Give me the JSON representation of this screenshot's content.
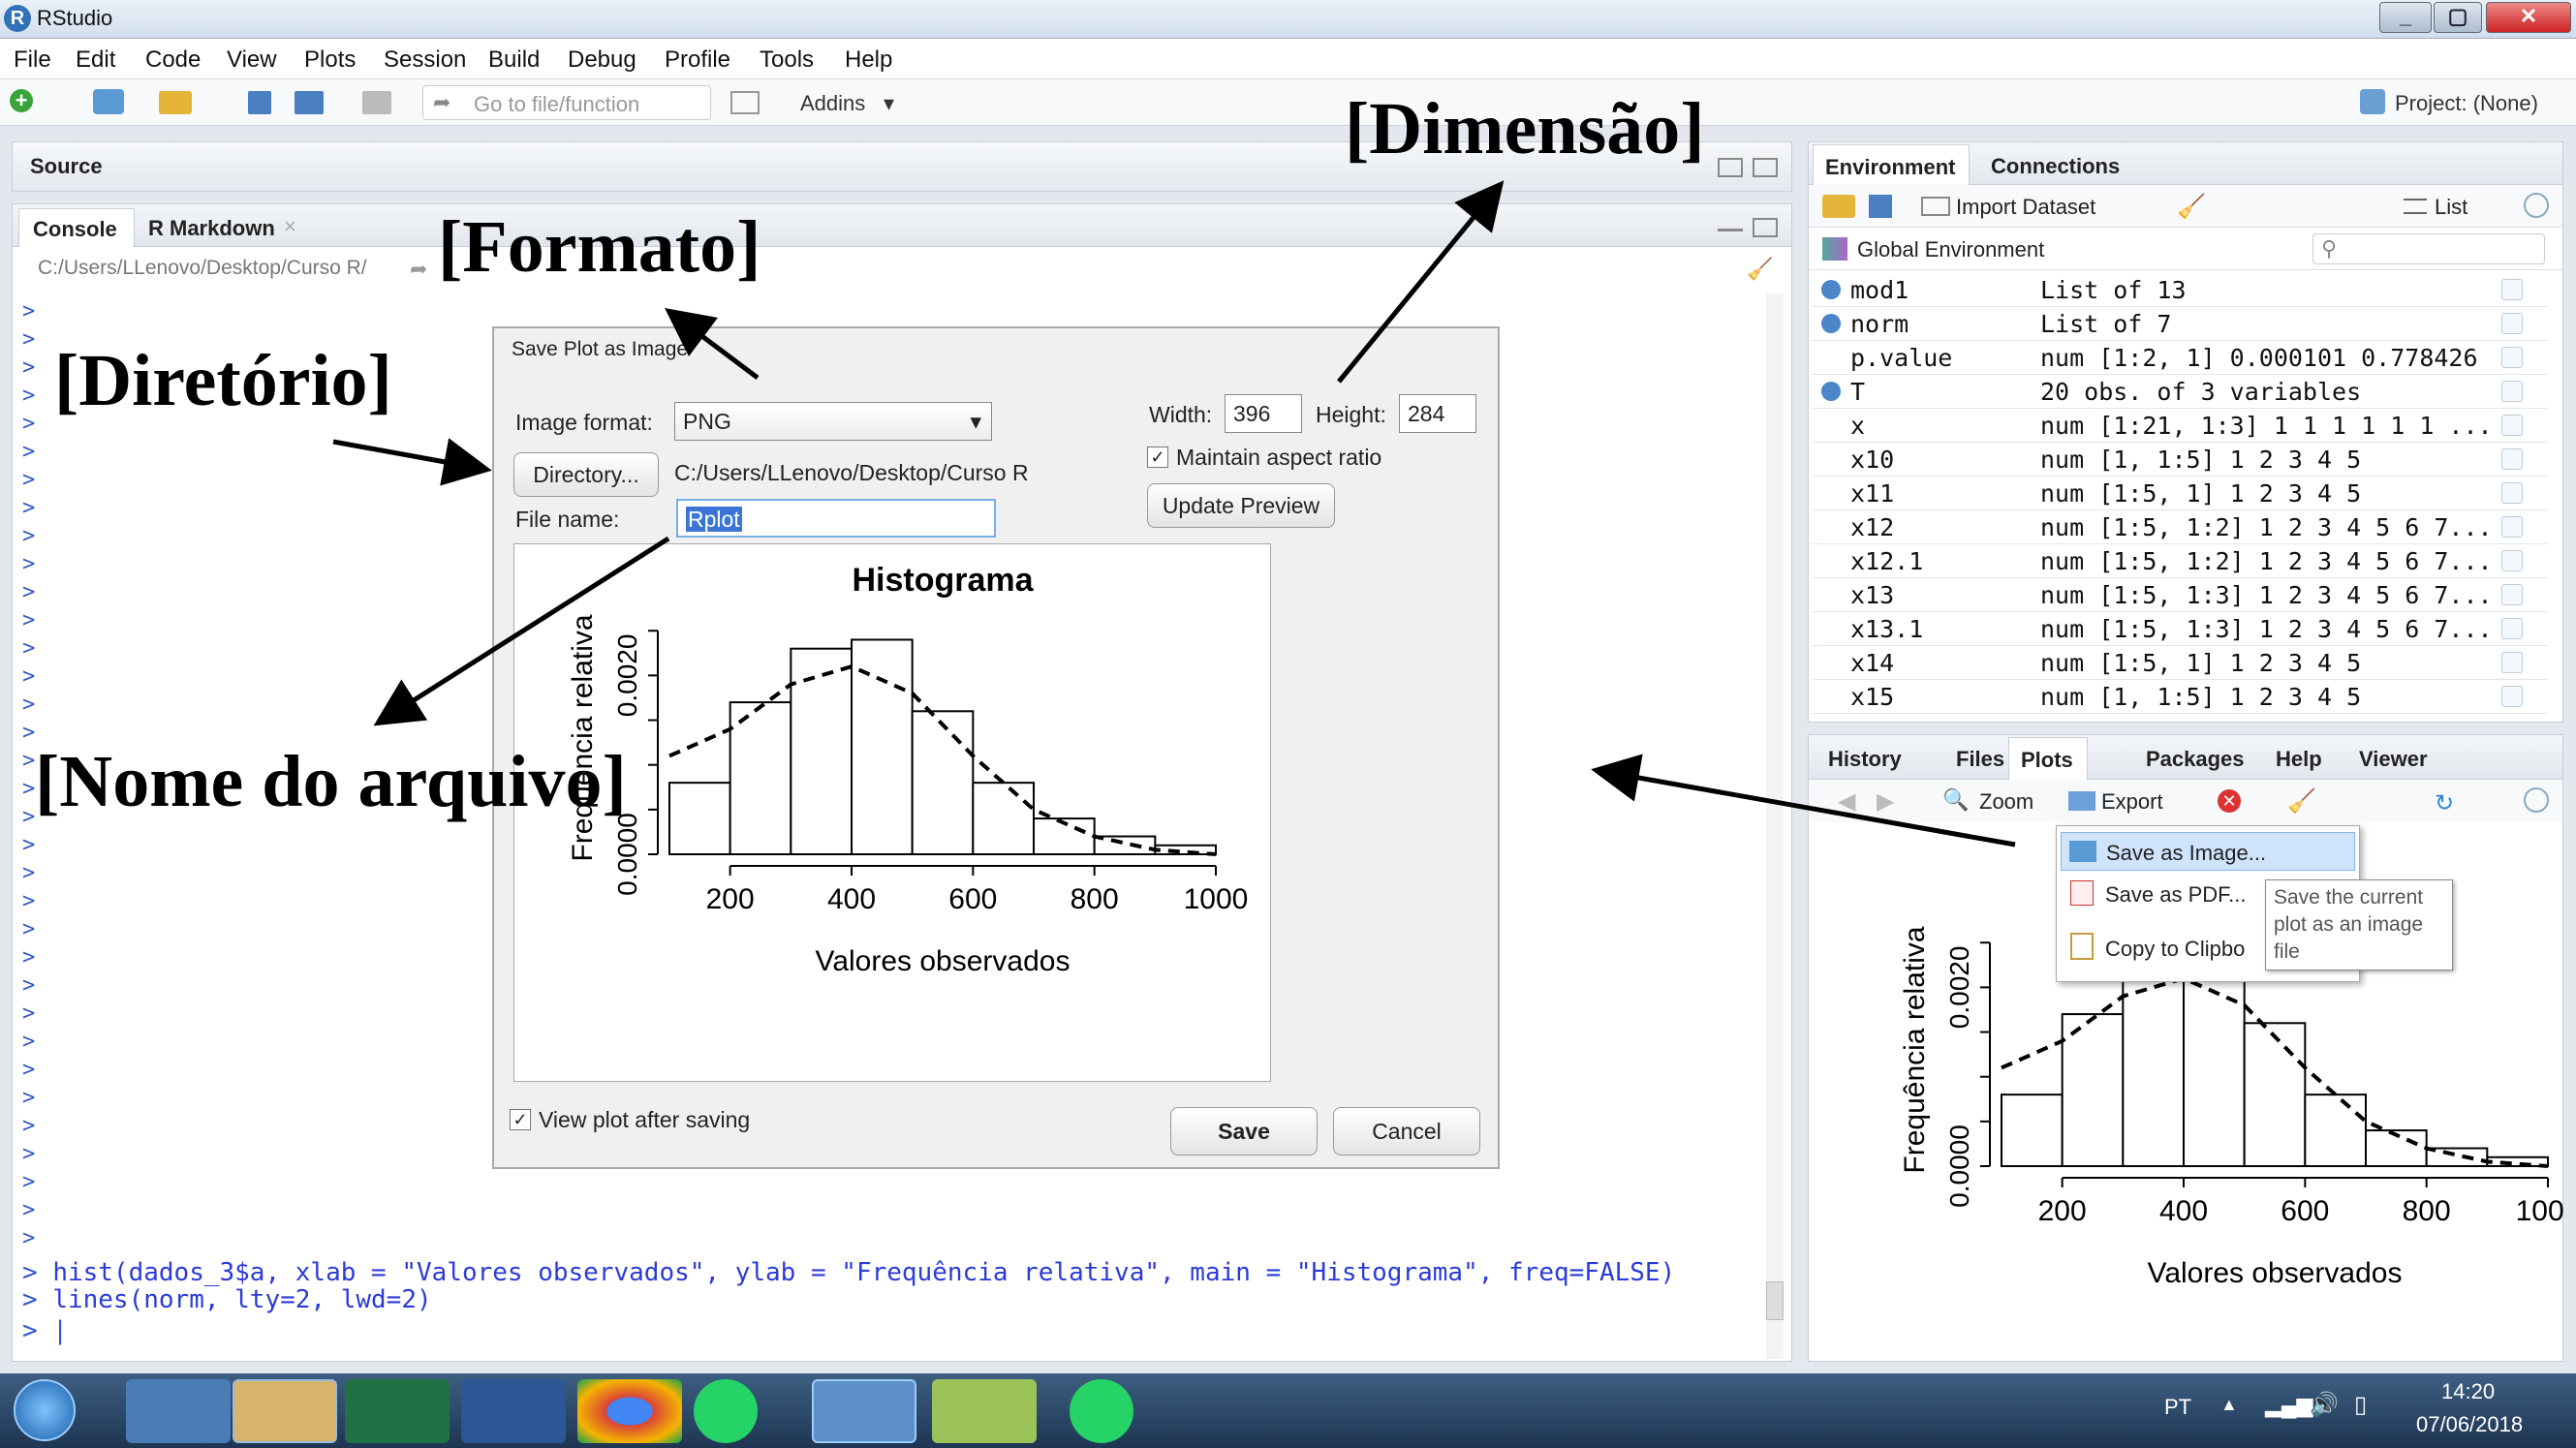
{
  "window": {
    "title": "RStudio",
    "min": "_",
    "max": "▢",
    "close": "✕"
  },
  "menu": [
    "File",
    "Edit",
    "Code",
    "View",
    "Plots",
    "Session",
    "Build",
    "Debug",
    "Profile",
    "Tools",
    "Help"
  ],
  "toolbar": {
    "goto_placeholder": "Go to file/function",
    "addins": "Addins",
    "project": "Project: (None)"
  },
  "source": {
    "label": "Source"
  },
  "console": {
    "tabs": [
      "Console",
      "R Markdown"
    ],
    "tab_close": "×",
    "path": "C:/Users/LLenovo/Desktop/Curso R/",
    "prompt": ">",
    "cmd1": "hist(dados_3$a, xlab = \"Valores observados\", ylab = \"Frequência relativa\", main = \"Histograma\", freq=FALSE)",
    "cmd2": "lines(norm, lty=2, lwd=2)"
  },
  "dialog": {
    "title": "Save Plot as Image",
    "format_label": "Image format:",
    "format_value": "PNG",
    "directory_button": "Directory...",
    "directory_path": "C:/Users/LLenovo/Desktop/Curso R",
    "filename_label": "File name:",
    "filename_value": "Rplot",
    "width_label": "Width:",
    "width_value": "396",
    "height_label": "Height:",
    "height_value": "284",
    "aspect_label": "Maintain aspect ratio",
    "update_button": "Update Preview",
    "view_after_label": "View plot after saving",
    "save_button": "Save",
    "cancel_button": "Cancel"
  },
  "histogram": {
    "title": "Histograma",
    "xlabel": "Valores observados",
    "ylabel": "Frequência relativa",
    "xticks": [
      "200",
      "400",
      "600",
      "800",
      "1000"
    ],
    "yticks": [
      "0.0000",
      "0.0020"
    ]
  },
  "chart_data": {
    "type": "bar",
    "title": "Histograma",
    "xlabel": "Valores observados",
    "ylabel": "Frequência relativa",
    "bin_edges": [
      100,
      200,
      300,
      400,
      500,
      600,
      700,
      800,
      900,
      1000
    ],
    "values": [
      0.0008,
      0.0017,
      0.0023,
      0.0024,
      0.0016,
      0.0008,
      0.0004,
      0.0002,
      0.0001
    ],
    "density_x": [
      100,
      200,
      300,
      400,
      500,
      600,
      700,
      800,
      900,
      1000
    ],
    "density_y": [
      0.0011,
      0.0014,
      0.0019,
      0.0021,
      0.0018,
      0.0011,
      0.0005,
      0.0002,
      5e-05,
      0.0
    ],
    "xlim": [
      100,
      1000
    ],
    "ylim": [
      0,
      0.0026
    ]
  },
  "annotations": {
    "dimensao": "[Dimensão]",
    "formato": "[Formato]",
    "diretorio": "[Diretório]",
    "nome": "[Nome do arquivo]"
  },
  "environment": {
    "tabs": [
      "Environment",
      "Connections"
    ],
    "import": "Import Dataset",
    "list": "List",
    "global": "Global Environment",
    "rows": [
      {
        "n": "mod1",
        "v": "List of 13"
      },
      {
        "n": "norm",
        "v": "List of 7"
      },
      {
        "n": "p.value",
        "v": "num [1:2, 1] 0.000101 0.778426"
      },
      {
        "n": "T",
        "v": "20 obs. of 3 variables"
      },
      {
        "n": "x",
        "v": "num [1:21, 1:3] 1 1 1 1 1 1 ..."
      },
      {
        "n": "x10",
        "v": "num [1, 1:5] 1 2 3 4 5"
      },
      {
        "n": "x11",
        "v": "num [1:5, 1] 1 2 3 4 5"
      },
      {
        "n": "x12",
        "v": "num [1:5, 1:2] 1 2 3 4 5 6 7..."
      },
      {
        "n": "x12.1",
        "v": "num [1:5, 1:2] 1 2 3 4 5 6 7..."
      },
      {
        "n": "x13",
        "v": "num [1:5, 1:3] 1 2 3 4 5 6 7..."
      },
      {
        "n": "x13.1",
        "v": "num [1:5, 1:3] 1 2 3 4 5 6 7..."
      },
      {
        "n": "x14",
        "v": "num [1:5, 1] 1 2 3 4 5"
      },
      {
        "n": "x15",
        "v": "num [1, 1:5] 1 2 3 4 5"
      }
    ]
  },
  "files": {
    "tabs": [
      "History",
      "Files",
      "Plots",
      "Packages",
      "Help",
      "Viewer"
    ],
    "zoom": "Zoom",
    "export": "Export"
  },
  "export_menu": {
    "items": [
      "Save as Image...",
      "Save as PDF...",
      "Copy to Clipbo"
    ],
    "tooltip": "Save the current plot as an image file"
  },
  "taskbar": {
    "lang": "PT",
    "time": "14:20",
    "date": "07/06/2018"
  }
}
